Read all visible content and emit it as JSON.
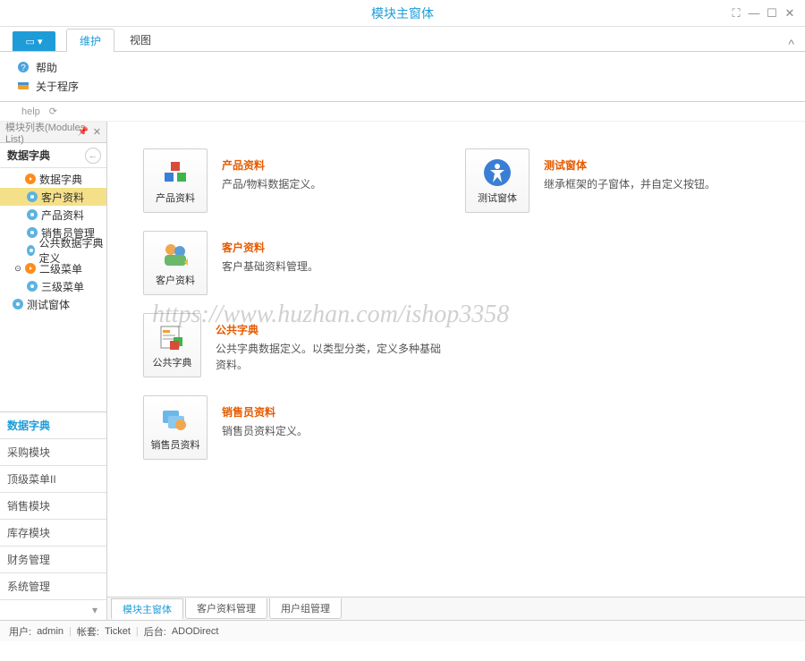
{
  "window": {
    "title": "模块主窗体"
  },
  "ribbon": {
    "tabs": [
      "维护",
      "视图"
    ],
    "items": [
      {
        "label": "帮助"
      },
      {
        "label": "关于程序"
      }
    ]
  },
  "quick": {
    "label": "help"
  },
  "sidebar": {
    "panel_title": "模块列表(Modules List)",
    "current_category": "数据字典",
    "tree": [
      {
        "label": "数据字典",
        "expanded": true,
        "icon": "orange",
        "level": 1
      },
      {
        "label": "客户资料",
        "icon": "blue",
        "level": 2,
        "selected": true
      },
      {
        "label": "产品资料",
        "icon": "blue",
        "level": 2
      },
      {
        "label": "销售员管理",
        "icon": "blue",
        "level": 2
      },
      {
        "label": "公共数据字典定义",
        "icon": "blue",
        "level": 2
      },
      {
        "label": "二级菜单",
        "expanded": true,
        "icon": "orange",
        "level": 1,
        "exp_symbol": "⊙"
      },
      {
        "label": "三级菜单",
        "icon": "blue",
        "level": 2
      },
      {
        "label": "测试窗体",
        "icon": "blue",
        "level": 1
      }
    ],
    "categories": [
      "数据字典",
      "采购模块",
      "顶级菜单II",
      "销售模块",
      "库存模块",
      "财务管理",
      "系统管理"
    ]
  },
  "tiles": [
    {
      "btn": "产品资料",
      "title": "产品资料",
      "desc": "产品/物料数据定义。",
      "icon": "cubes"
    },
    {
      "btn": "测试窗体",
      "title": "测试窗体",
      "desc": "继承框架的子窗体，并自定义按钮。",
      "icon": "accessibility"
    },
    {
      "btn": "客户资料",
      "title": "客户资料",
      "desc": "客户基础资料管理。",
      "icon": "users"
    },
    {
      "btn": "",
      "title": "",
      "desc": "",
      "icon": "",
      "empty": true
    },
    {
      "btn": "公共字典",
      "title": "公共字典",
      "desc": "公共字典数据定义。以类型分类，定义多种基础资料。",
      "icon": "dict"
    },
    {
      "btn": "",
      "title": "",
      "desc": "",
      "icon": "",
      "empty": true
    },
    {
      "btn": "销售员资料",
      "title": "销售员资料",
      "desc": "销售员资料定义。",
      "icon": "sales"
    }
  ],
  "watermark": "https://www.huzhan.com/ishop3358",
  "doc_tabs": [
    "模块主窗体",
    "客户资料管理",
    "用户组管理"
  ],
  "status": {
    "user_label": "用户:",
    "user_value": "admin",
    "account_label": "帐套:",
    "account_value": "Ticket",
    "backend_label": "后台:",
    "backend_value": "ADODirect"
  }
}
